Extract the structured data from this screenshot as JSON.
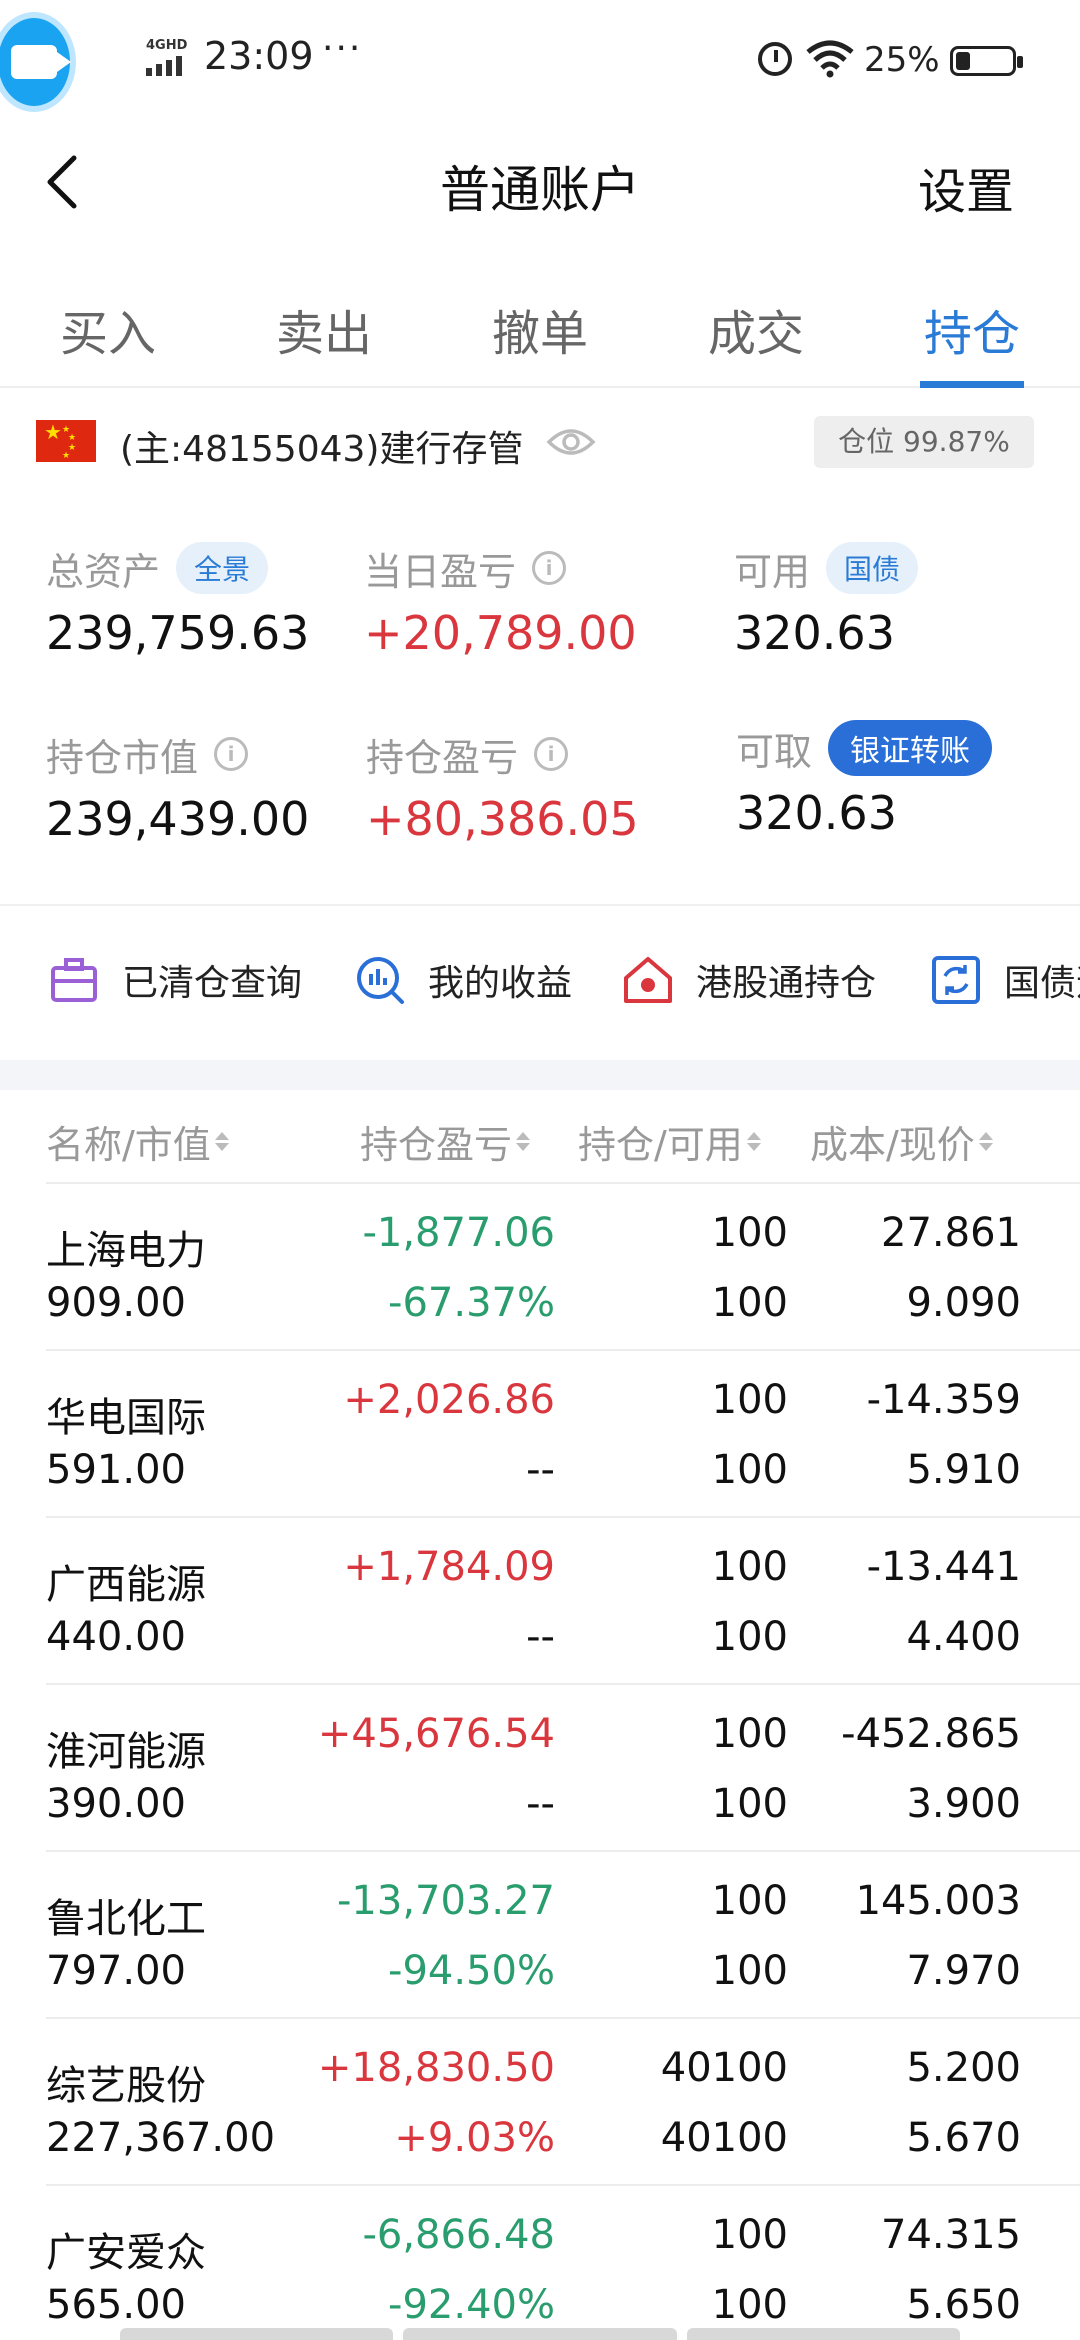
{
  "status_bar": {
    "network": "4GHD",
    "time": "23:09",
    "more": "···",
    "battery_percent": "25%",
    "battery_level": 0.25
  },
  "header": {
    "title": "普通账户",
    "settings": "设置",
    "back_icon": "chevron-left-icon"
  },
  "tabs": [
    {
      "label": "买入",
      "active": false
    },
    {
      "label": "卖出",
      "active": false
    },
    {
      "label": "撤单",
      "active": false
    },
    {
      "label": "成交",
      "active": false
    },
    {
      "label": "持仓",
      "active": true
    }
  ],
  "account": {
    "text": "(主:48155043)建行存管",
    "position_ratio": "仓位 99.87%"
  },
  "summary": {
    "total_assets_label": "总资产",
    "total_assets_tag": "全景",
    "total_assets": "239,759.63",
    "daily_pl_label": "当日盈亏",
    "daily_pl": "+20,789.00",
    "available_label": "可用",
    "available_tag": "国债",
    "available": "320.63",
    "market_value_label": "持仓市值",
    "market_value": "239,439.00",
    "holding_pl_label": "持仓盈亏",
    "holding_pl": "+80,386.05",
    "withdrawable_label": "可取",
    "withdrawable_tag": "银证转账",
    "withdrawable": "320.63"
  },
  "shortcuts": [
    {
      "label": "已清仓查询",
      "icon": "briefcase-icon",
      "color": "#9b5fd6"
    },
    {
      "label": "我的收益",
      "icon": "chart-search-icon",
      "color": "#2a6fd8"
    },
    {
      "label": "港股通持仓",
      "icon": "hk-house-icon",
      "color": "#d9363e"
    },
    {
      "label": "国债逆",
      "icon": "refresh-square-icon",
      "color": "#2a6fd8"
    }
  ],
  "table": {
    "headers": [
      "名称/市值",
      "持仓盈亏",
      "持仓/可用",
      "成本/现价"
    ],
    "rows": [
      {
        "name": "上海电力",
        "market_value": "909.00",
        "pl": "-1,877.06",
        "pl_pct": "-67.37%",
        "holding": "100",
        "available": "100",
        "cost": "27.861",
        "price": "9.090",
        "tone": "green"
      },
      {
        "name": "华电国际",
        "market_value": "591.00",
        "pl": "+2,026.86",
        "pl_pct": "--",
        "holding": "100",
        "available": "100",
        "cost": "-14.359",
        "price": "5.910",
        "tone": "red"
      },
      {
        "name": "广西能源",
        "market_value": "440.00",
        "pl": "+1,784.09",
        "pl_pct": "--",
        "holding": "100",
        "available": "100",
        "cost": "-13.441",
        "price": "4.400",
        "tone": "red"
      },
      {
        "name": "淮河能源",
        "market_value": "390.00",
        "pl": "+45,676.54",
        "pl_pct": "--",
        "holding": "100",
        "available": "100",
        "cost": "-452.865",
        "price": "3.900",
        "tone": "red"
      },
      {
        "name": "鲁北化工",
        "market_value": "797.00",
        "pl": "-13,703.27",
        "pl_pct": "-94.50%",
        "holding": "100",
        "available": "100",
        "cost": "145.003",
        "price": "7.970",
        "tone": "green"
      },
      {
        "name": "综艺股份",
        "market_value": "227,367.00",
        "pl": "+18,830.50",
        "pl_pct": "+9.03%",
        "holding": "40100",
        "available": "40100",
        "cost": "5.200",
        "price": "5.670",
        "tone": "red"
      },
      {
        "name": "广安爱众",
        "market_value": "565.00",
        "pl": "-6,866.48",
        "pl_pct": "-92.40%",
        "holding": "100",
        "available": "100",
        "cost": "74.315",
        "price": "5.650",
        "tone": "green"
      }
    ]
  },
  "colors": {
    "accent": "#2a7bd6",
    "gain": "#d9363e",
    "loss": "#2a9d6e"
  }
}
